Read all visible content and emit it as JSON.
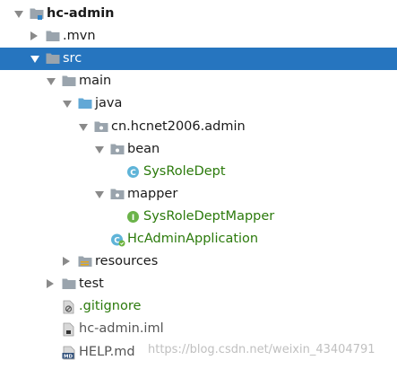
{
  "tree": [
    {
      "id": "hc-admin",
      "label": "hc-admin",
      "arrow": "open",
      "icon": "module-folder-icon",
      "style": "bold",
      "indent": 0
    },
    {
      "id": "mvn",
      "label": ".mvn",
      "arrow": "closed",
      "icon": "folder-icon",
      "style": "normal",
      "indent": 1
    },
    {
      "id": "src",
      "label": "src",
      "arrow": "open",
      "icon": "folder-icon",
      "style": "normal",
      "indent": 1,
      "selected": true
    },
    {
      "id": "main",
      "label": "main",
      "arrow": "open",
      "icon": "folder-icon",
      "style": "normal",
      "indent": 2
    },
    {
      "id": "java",
      "label": "java",
      "arrow": "open",
      "icon": "source-folder-icon",
      "style": "normal",
      "indent": 3
    },
    {
      "id": "package",
      "label": "cn.hcnet2006.admin",
      "arrow": "open",
      "icon": "package-icon",
      "style": "normal",
      "indent": 4
    },
    {
      "id": "bean",
      "label": "bean",
      "arrow": "open",
      "icon": "package-icon",
      "style": "normal",
      "indent": 5
    },
    {
      "id": "sysroledept",
      "label": "SysRoleDept",
      "arrow": "none",
      "icon": "class-icon",
      "style": "green",
      "indent": 6
    },
    {
      "id": "mapper",
      "label": "mapper",
      "arrow": "open",
      "icon": "package-icon",
      "style": "normal",
      "indent": 5
    },
    {
      "id": "sysroledeptmapper",
      "label": "SysRoleDeptMapper",
      "arrow": "none",
      "icon": "interface-icon",
      "style": "green",
      "indent": 6
    },
    {
      "id": "hcadminapplication",
      "label": "HcAdminApplication",
      "arrow": "none",
      "icon": "spring-class-icon",
      "style": "green",
      "indent": 5
    },
    {
      "id": "resources",
      "label": "resources",
      "arrow": "closed",
      "icon": "resources-folder-icon",
      "style": "normal",
      "indent": 3
    },
    {
      "id": "test",
      "label": "test",
      "arrow": "closed",
      "icon": "folder-icon",
      "style": "normal",
      "indent": 2
    },
    {
      "id": "gitignore",
      "label": ".gitignore",
      "arrow": "none",
      "icon": "gitignore-file-icon",
      "style": "green",
      "indent": 2
    },
    {
      "id": "iml",
      "label": "hc-admin.iml",
      "arrow": "none",
      "icon": "iml-file-icon",
      "style": "gray",
      "indent": 2
    },
    {
      "id": "help",
      "label": "HELP.md",
      "arrow": "none",
      "icon": "markdown-file-icon",
      "style": "gray",
      "indent": 2
    }
  ],
  "watermark": "https://blog.csdn.net/weixin_43404791",
  "colors": {
    "selection": "#2675bf",
    "folder": "#9aa4ad",
    "source_folder": "#62a8d6",
    "class_icon": "#5fb4d8",
    "interface_icon": "#6bb34a",
    "green_text": "#2b7a0b"
  }
}
